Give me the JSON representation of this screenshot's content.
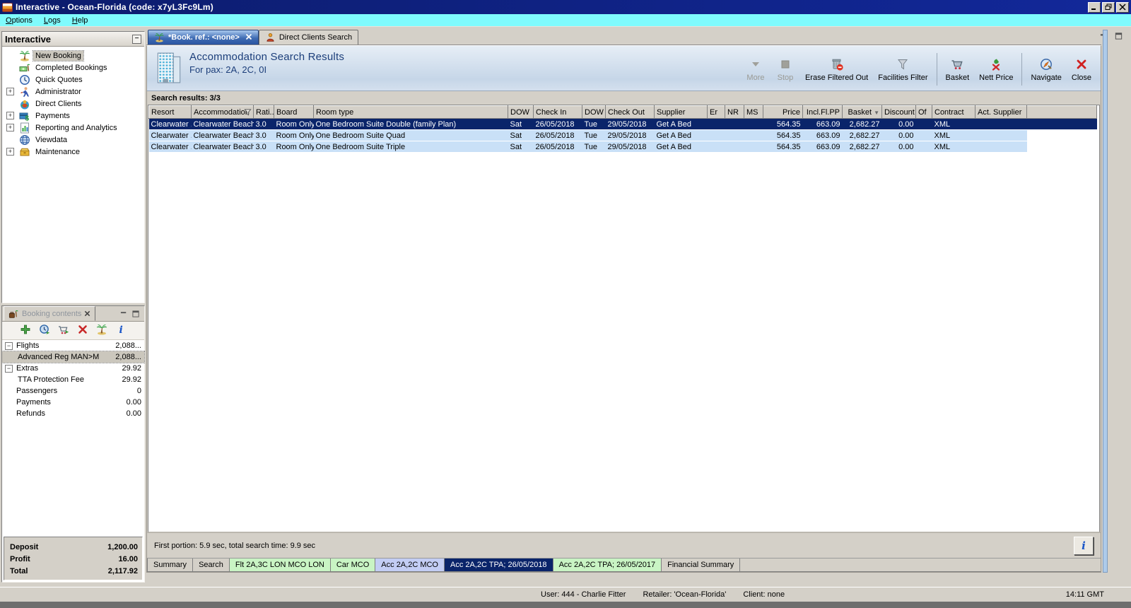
{
  "window": {
    "title": "Interactive - Ocean-Florida (code: x7yL3Fc9Lm)"
  },
  "menu": {
    "items": [
      "Options",
      "Logs",
      "Help"
    ]
  },
  "sidebar": {
    "title": "Interactive",
    "items": [
      {
        "label": "New Booking",
        "icon": "palm-tree-icon",
        "selected": true
      },
      {
        "label": "Completed Bookings",
        "icon": "completed-bookings-icon"
      },
      {
        "label": "Quick Quotes",
        "icon": "quick-quotes-icon"
      },
      {
        "label": "Administrator",
        "icon": "administrator-icon",
        "expand": "plus"
      },
      {
        "label": "Direct Clients",
        "icon": "direct-clients-icon"
      },
      {
        "label": "Payments",
        "icon": "payments-icon",
        "expand": "plus"
      },
      {
        "label": "Reporting and Analytics",
        "icon": "reporting-icon",
        "expand": "plus"
      },
      {
        "label": "Viewdata",
        "icon": "viewdata-icon"
      },
      {
        "label": "Maintenance",
        "icon": "maintenance-icon",
        "expand": "plus"
      }
    ]
  },
  "booking_contents": {
    "title": "Booking contents",
    "toolbar": [
      {
        "icon": "add-icon",
        "name": "add-item-button"
      },
      {
        "icon": "refresh-clock-icon",
        "name": "refresh-button"
      },
      {
        "icon": "cart-add-icon",
        "name": "add-to-basket-button"
      },
      {
        "icon": "delete-icon",
        "name": "delete-item-button"
      },
      {
        "icon": "palm-tree-icon",
        "name": "booking-button"
      },
      {
        "icon": "info-icon",
        "name": "item-info-button"
      }
    ],
    "rows": [
      {
        "label": "Flights",
        "value": "2,088...",
        "level": 0,
        "expand": "minus"
      },
      {
        "label": "Advanced Reg MAN>M",
        "value": "2,088...",
        "level": 1,
        "selected": true
      },
      {
        "label": "Extras",
        "value": "29.92",
        "level": 0,
        "expand": "minus"
      },
      {
        "label": "TTA Protection Fee",
        "value": "29.92",
        "level": 1
      },
      {
        "label": "Passengers",
        "value": "0",
        "level": 0
      },
      {
        "label": "Payments",
        "value": "0.00",
        "level": 0
      },
      {
        "label": "Refunds",
        "value": "0.00",
        "level": 0
      }
    ],
    "summary": [
      {
        "label": "Deposit",
        "value": "1,200.00"
      },
      {
        "label": "Profit",
        "value": "16.00"
      },
      {
        "label": "Total",
        "value": "2,117.92"
      }
    ]
  },
  "tabs": [
    {
      "label": "*Book. ref.: <none>",
      "icon": "palm-tree-icon",
      "active": true,
      "closable": true
    },
    {
      "label": "Direct Clients Search",
      "icon": "client-person-icon",
      "active": false
    }
  ],
  "header": {
    "title": "Accommodation Search Results",
    "subtitle": "For pax: 2A, 2C, 0I"
  },
  "action_bar": {
    "groups": [
      {
        "buttons": [
          {
            "label": "More",
            "icon": "more-icon",
            "disabled": true
          },
          {
            "label": "Stop",
            "icon": "stop-icon",
            "disabled": true
          },
          {
            "label": "Erase Filtered Out",
            "icon": "erase-filtered-out-icon"
          },
          {
            "label": "Facilities Filter",
            "icon": "facilities-filter-icon"
          }
        ]
      },
      {
        "buttons": [
          {
            "label": "Basket",
            "icon": "basket-icon"
          },
          {
            "label": "Nett Price",
            "icon": "nett-price-icon"
          }
        ]
      },
      {
        "buttons": [
          {
            "label": "Navigate",
            "icon": "navigate-icon"
          },
          {
            "label": "Close",
            "icon": "close-red-icon"
          }
        ]
      }
    ]
  },
  "results": {
    "status": "Search results: 3/3",
    "columns": [
      "Resort",
      "Accommodation",
      "Rati...",
      "Board",
      "Room type",
      "DOW",
      "Check In",
      "DOW",
      "Check Out",
      "Supplier",
      "Er",
      "NR",
      "MS",
      "Price",
      "Incl.Fl.PP",
      "Basket",
      "Discount",
      "Of",
      "Contract",
      "Act. Supplier"
    ],
    "filtered_column": "Accommodation",
    "sorted_column": "Basket",
    "selected_row": 0,
    "rows": [
      [
        "Clearwater ...",
        "Clearwater Beach Ma...",
        "3.0",
        "Room Only",
        "One Bedroom Suite Double (family Plan)",
        "Sat",
        "26/05/2018",
        "Tue",
        "29/05/2018",
        "Get A Bed",
        "",
        "",
        "",
        "564.35",
        "663.09",
        "2,682.27",
        "0.00",
        "",
        "XML",
        ""
      ],
      [
        "Clearwater ...",
        "Clearwater Beach Ma...",
        "3.0",
        "Room Only",
        "One Bedroom Suite Quad",
        "Sat",
        "26/05/2018",
        "Tue",
        "29/05/2018",
        "Get A Bed",
        "",
        "",
        "",
        "564.35",
        "663.09",
        "2,682.27",
        "0.00",
        "",
        "XML",
        ""
      ],
      [
        "Clearwater ...",
        "Clearwater Beach Ma...",
        "3.0",
        "Room Only",
        "One Bedroom Suite Triple",
        "Sat",
        "26/05/2018",
        "Tue",
        "29/05/2018",
        "Get A Bed",
        "",
        "",
        "",
        "564.35",
        "663.09",
        "2,682.27",
        "0.00",
        "",
        "XML",
        ""
      ]
    ],
    "footer": "First portion: 5.9 sec, total search time: 9.9 sec",
    "info_label": "i"
  },
  "bottom_tabs": [
    {
      "label": "Summary",
      "type": "plain"
    },
    {
      "label": "Search",
      "type": "plain"
    },
    {
      "label": "Flt 2A,3C LON MCO LON",
      "type": "green"
    },
    {
      "label": "Car MCO",
      "type": "green"
    },
    {
      "label": "Acc 2A,2C MCO",
      "type": "lavender"
    },
    {
      "label": "Acc 2A,2C TPA; 26/05/2018",
      "type": "selected"
    },
    {
      "label": "Acc 2A,2C TPA; 26/05/2017",
      "type": "green"
    },
    {
      "label": "Financial Summary",
      "type": "plain"
    }
  ],
  "status_bar": {
    "user": "User: 444 - Charlie Fitter",
    "retailer": "Retailer: 'Ocean-Florida'",
    "client": "Client: none",
    "time": "14:11 GMT"
  },
  "colors": {
    "title_navy": "#0c1c6c",
    "menu_cyan": "#7ffbfd",
    "selection_navy": "#0a246a",
    "row_blue": "#c9e0f7",
    "tab_green": "#c9f4c4",
    "tab_lavender": "#c3cdf4",
    "header_text_blue": "#1c3e7a"
  }
}
